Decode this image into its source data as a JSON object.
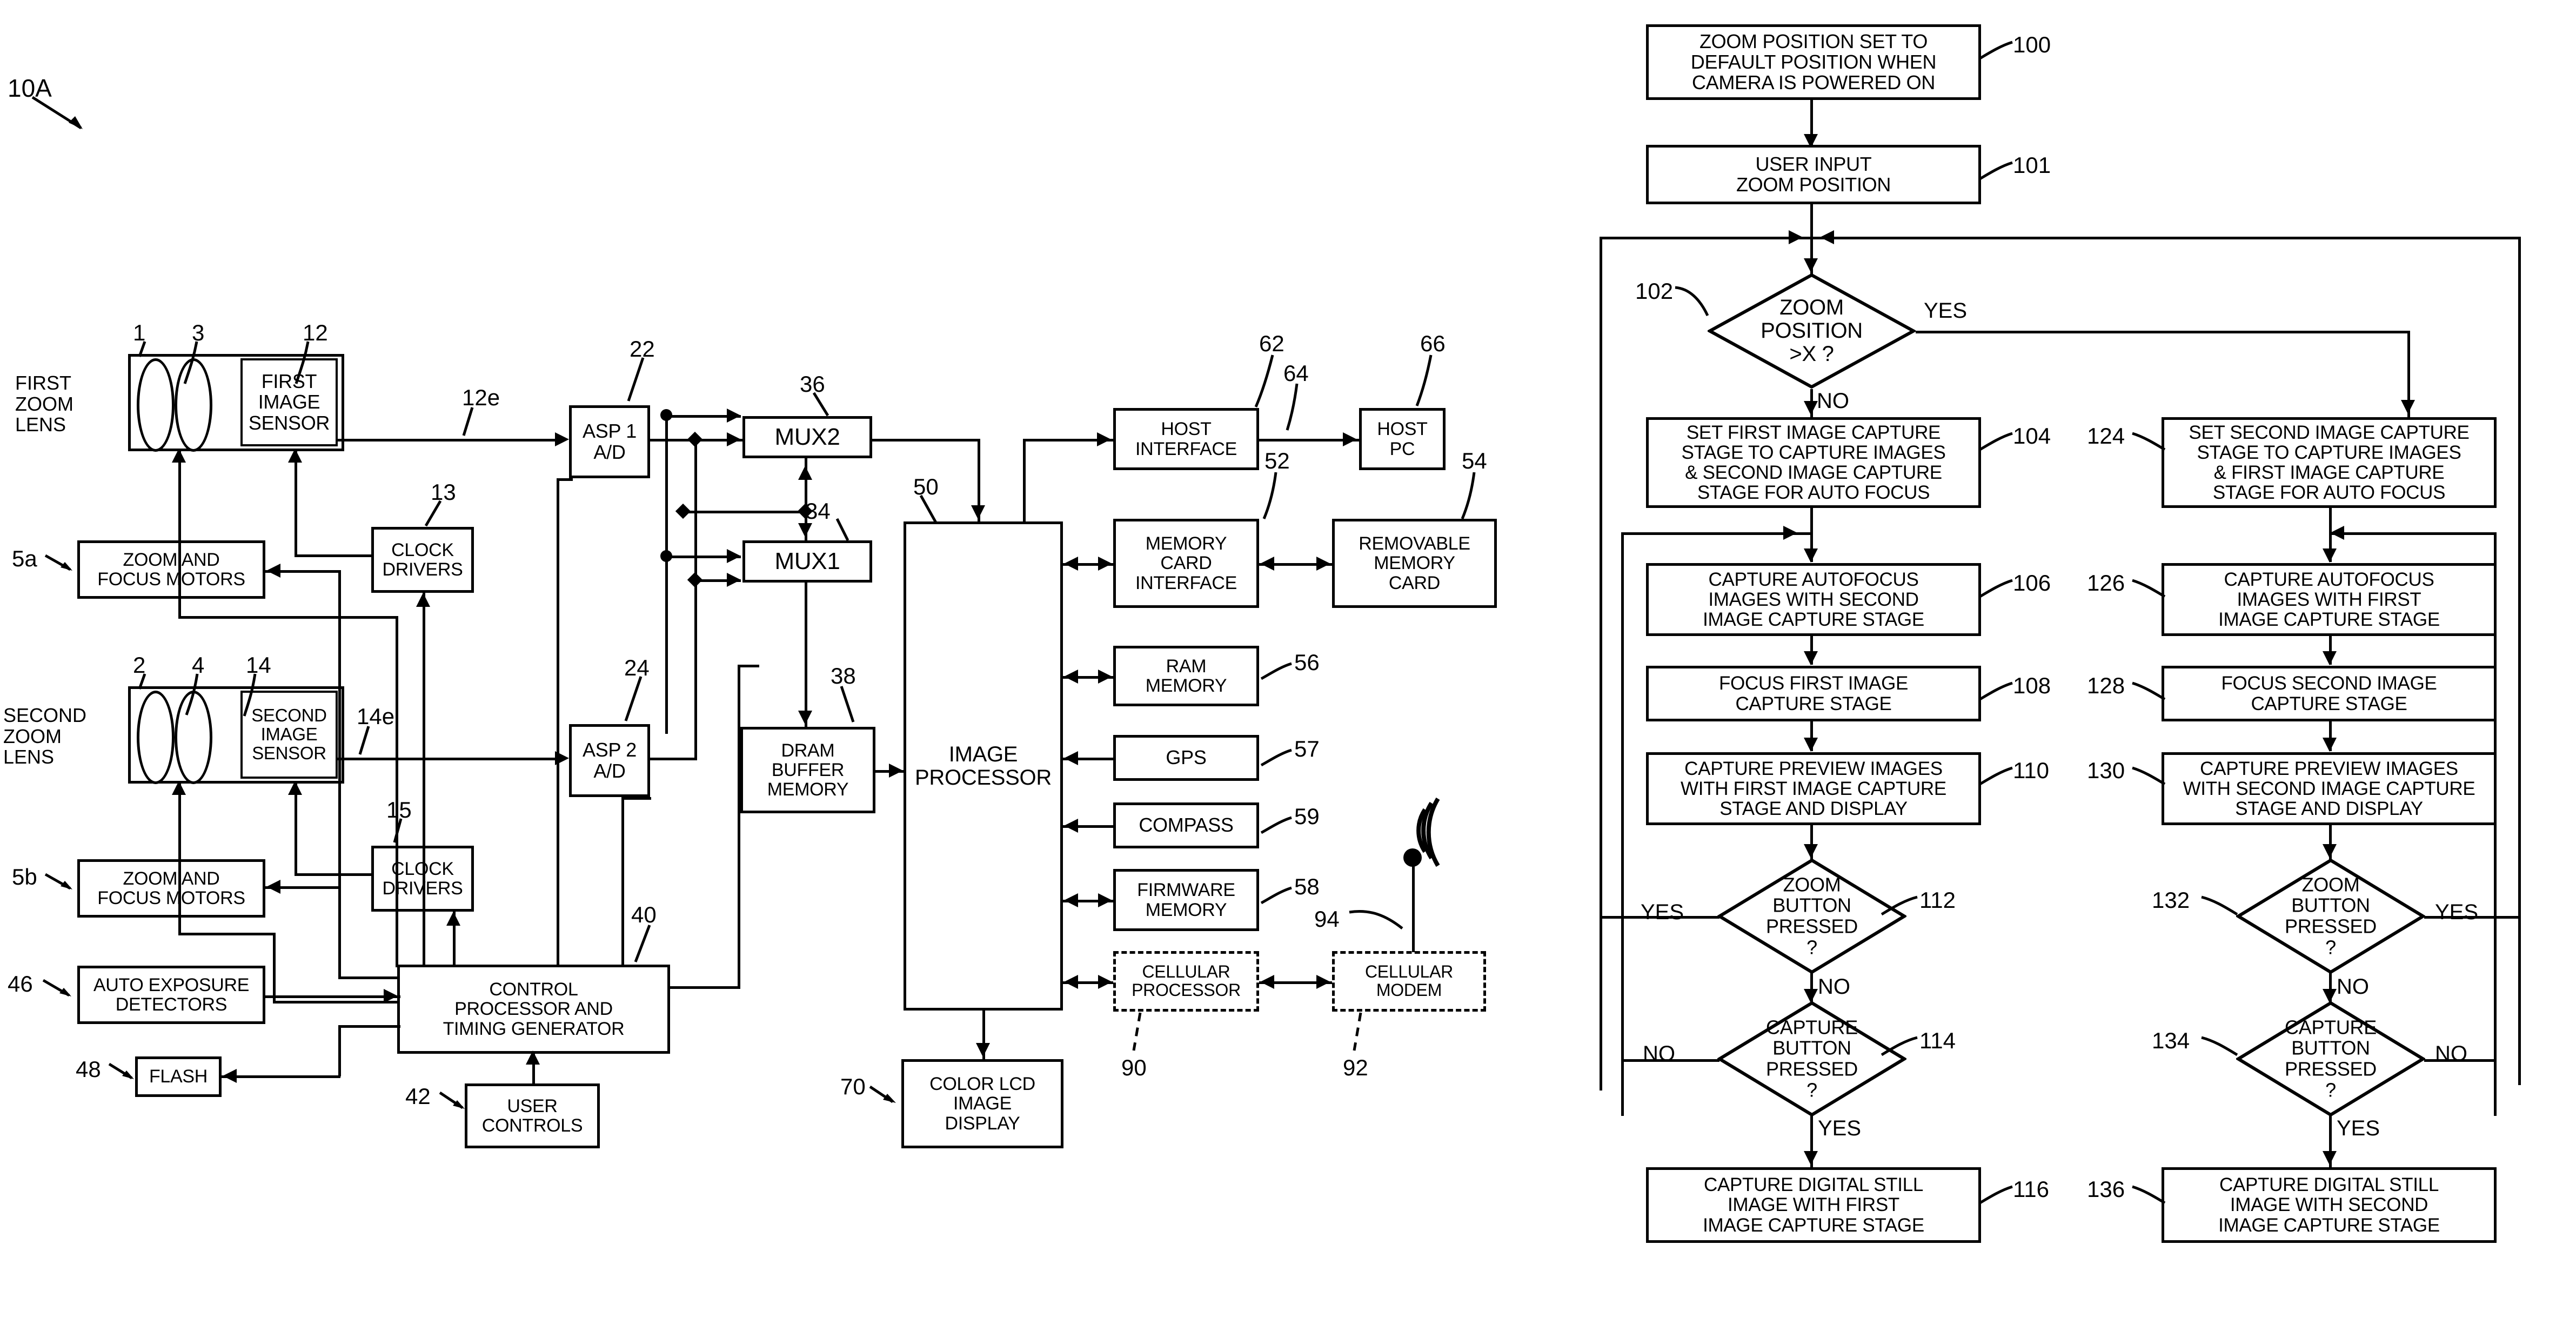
{
  "figure": {
    "system_ref": "10A",
    "left_title": "Digital camera block diagram",
    "right_title": "Zoom position control flowchart"
  },
  "camera_block_diagram": {
    "blocks": [
      {
        "id": "first_capture_stage",
        "ref": "1",
        "label": "FIRST\nZOOM\nLENS"
      },
      {
        "id": "first_lens_elem",
        "ref": "3",
        "label": ""
      },
      {
        "id": "first_image_sensor",
        "ref": "12",
        "label": "FIRST\nIMAGE\nSENSOR"
      },
      {
        "id": "zoom_focus_motors_a",
        "ref": "5a",
        "label": "ZOOM AND\nFOCUS MOTORS"
      },
      {
        "id": "clock_drivers_1",
        "ref": "13",
        "label": "CLOCK\nDRIVERS"
      },
      {
        "id": "second_capture_stage",
        "ref": "2",
        "label": "SECOND\nZOOM\nLENS"
      },
      {
        "id": "second_lens_elem",
        "ref": "4",
        "label": ""
      },
      {
        "id": "second_image_sensor",
        "ref": "14",
        "label": "SECOND\nIMAGE\nSENSOR"
      },
      {
        "id": "zoom_focus_motors_b",
        "ref": "5b",
        "label": "ZOOM AND\nFOCUS MOTORS"
      },
      {
        "id": "clock_drivers_2",
        "ref": "15",
        "label": "CLOCK\nDRIVERS"
      },
      {
        "id": "auto_exposure",
        "ref": "46",
        "label": "AUTO EXPOSURE\nDETECTORS"
      },
      {
        "id": "flash",
        "ref": "48",
        "label": "FLASH"
      },
      {
        "id": "control_processor",
        "ref": "40",
        "label": "CONTROL\nPROCESSOR AND\nTIMING GENERATOR"
      },
      {
        "id": "user_controls",
        "ref": "42",
        "label": "USER\nCONTROLS"
      },
      {
        "id": "asp1",
        "ref": "22",
        "label": "ASP 1\nA/D"
      },
      {
        "id": "asp2",
        "ref": "24",
        "label": "ASP 2\nA/D"
      },
      {
        "id": "mux2",
        "ref": "36",
        "label": "MUX2"
      },
      {
        "id": "mux1",
        "ref": "34",
        "label": "MUX1"
      },
      {
        "id": "dram_buffer",
        "ref": "38",
        "label": "DRAM\nBUFFER\nMEMORY"
      },
      {
        "id": "image_processor",
        "ref": "50",
        "label": "IMAGE\nPROCESSOR"
      },
      {
        "id": "host_interface",
        "ref": "62",
        "label": "HOST\nINTERFACE"
      },
      {
        "id": "host_pc",
        "ref": "66",
        "label": "HOST\nPC"
      },
      {
        "id": "memory_card_iface",
        "ref": "52",
        "label": "MEMORY\nCARD\nINTERFACE"
      },
      {
        "id": "removable_card",
        "ref": "54",
        "label": "REMOVABLE\nMEMORY\nCARD"
      },
      {
        "id": "ram_memory",
        "ref": "56",
        "label": "RAM\nMEMORY"
      },
      {
        "id": "gps",
        "ref": "57",
        "label": "GPS"
      },
      {
        "id": "compass",
        "ref": "59",
        "label": "COMPASS"
      },
      {
        "id": "firmware_memory",
        "ref": "58",
        "label": "FIRMWARE\nMEMORY"
      },
      {
        "id": "cellular_processor",
        "ref": "90",
        "label": "CELLULAR\nPROCESSOR"
      },
      {
        "id": "cellular_modem",
        "ref": "92",
        "label": "CELLULAR\nMODEM"
      },
      {
        "id": "antenna",
        "ref": "94",
        "label": ""
      },
      {
        "id": "color_lcd",
        "ref": "70",
        "label": "COLOR LCD\nIMAGE\nDISPLAY"
      }
    ],
    "signal_labels": [
      {
        "id": "first_sensor_output",
        "ref": "12e"
      },
      {
        "id": "second_sensor_output",
        "ref": "14e"
      },
      {
        "id": "host_link",
        "ref": "64"
      }
    ],
    "text": {
      "first_zoom_lens": "FIRST\nZOOM\nLENS",
      "first_zoom_lens_l1": "FIRST",
      "first_zoom_lens_l2": "ZOOM",
      "first_zoom_lens_l3": "LENS",
      "second_zoom_lens_l1": "SECOND",
      "second_zoom_lens_l2": "ZOOM",
      "second_zoom_lens_l3": "LENS",
      "first_image_sensor_l1": "FIRST",
      "first_image_sensor_l2": "IMAGE",
      "first_image_sensor_l3": "SENSOR",
      "second_image_sensor_l1": "SECOND",
      "second_image_sensor_l2": "IMAGE",
      "second_image_sensor_l3": "SENSOR",
      "zoom_focus_motors_l1": "ZOOM AND",
      "zoom_focus_motors_l2": "FOCUS MOTORS",
      "clock_drivers_l1": "CLOCK",
      "clock_drivers_l2": "DRIVERS",
      "auto_exposure_l1": "AUTO EXPOSURE",
      "auto_exposure_l2": "DETECTORS",
      "flash": "FLASH",
      "control_processor_l1": "CONTROL",
      "control_processor_l2": "PROCESSOR AND",
      "control_processor_l3": "TIMING GENERATOR",
      "user_controls_l1": "USER",
      "user_controls_l2": "CONTROLS",
      "asp1_l1": "ASP 1",
      "asp1_l2": "A/D",
      "asp2_l1": "ASP 2",
      "asp2_l2": "A/D",
      "mux2": "MUX2",
      "mux1": "MUX1",
      "dram_l1": "DRAM",
      "dram_l2": "BUFFER",
      "dram_l3": "MEMORY",
      "image_processor_l1": "IMAGE",
      "image_processor_l2": "PROCESSOR",
      "host_interface_l1": "HOST",
      "host_interface_l2": "INTERFACE",
      "host_pc_l1": "HOST",
      "host_pc_l2": "PC",
      "memory_card_iface_l1": "MEMORY",
      "memory_card_iface_l2": "CARD",
      "memory_card_iface_l3": "INTERFACE",
      "removable_card_l1": "REMOVABLE",
      "removable_card_l2": "MEMORY",
      "removable_card_l3": "CARD",
      "ram_memory_l1": "RAM",
      "ram_memory_l2": "MEMORY",
      "gps": "GPS",
      "compass": "COMPASS",
      "firmware_memory_l1": "FIRMWARE",
      "firmware_memory_l2": "MEMORY",
      "cellular_processor_l1": "CELLULAR",
      "cellular_processor_l2": "PROCESSOR",
      "cellular_modem_l1": "CELLULAR",
      "cellular_modem_l2": "MODEM",
      "color_lcd_l1": "COLOR LCD",
      "color_lcd_l2": "IMAGE",
      "color_lcd_l3": "DISPLAY"
    },
    "refs": {
      "system": "10A",
      "n1": "1",
      "n2": "2",
      "n3": "3",
      "n4": "4",
      "n5a": "5a",
      "n5b": "5b",
      "n12": "12",
      "n12e": "12e",
      "n13": "13",
      "n14": "14",
      "n14e": "14e",
      "n15": "15",
      "n22": "22",
      "n24": "24",
      "n34": "34",
      "n36": "36",
      "n38": "38",
      "n40": "40",
      "n42": "42",
      "n46": "46",
      "n48": "48",
      "n50": "50",
      "n52": "52",
      "n54": "54",
      "n56": "56",
      "n57": "57",
      "n58": "58",
      "n59": "59",
      "n62": "62",
      "n64": "64",
      "n66": "66",
      "n70": "70",
      "n90": "90",
      "n92": "92",
      "n94": "94"
    }
  },
  "flowchart": {
    "refs": {
      "n100": "100",
      "n101": "101",
      "n102": "102",
      "n104": "104",
      "n106": "106",
      "n108": "108",
      "n110": "110",
      "n112": "112",
      "n114": "114",
      "n116": "116",
      "n124": "124",
      "n126": "126",
      "n128": "128",
      "n130": "130",
      "n132": "132",
      "n134": "134",
      "n136": "136"
    },
    "steps": [
      {
        "ref": "100",
        "type": "process",
        "text": "ZOOM POSITION SET TO\nDEFAULT POSITION WHEN\nCAMERA IS POWERED ON"
      },
      {
        "ref": "101",
        "type": "process",
        "text": "USER INPUT\nZOOM POSITION"
      },
      {
        "ref": "102",
        "type": "decision",
        "text": "ZOOM\nPOSITION\n>X ?",
        "yes": "YES",
        "no": "NO"
      },
      {
        "ref": "104",
        "type": "process",
        "text": "SET FIRST IMAGE CAPTURE\nSTAGE TO CAPTURE IMAGES\n& SECOND IMAGE CAPTURE\nSTAGE FOR AUTO FOCUS"
      },
      {
        "ref": "106",
        "type": "process",
        "text": "CAPTURE AUTOFOCUS\nIMAGES WITH SECOND\nIMAGE CAPTURE STAGE"
      },
      {
        "ref": "108",
        "type": "process",
        "text": "FOCUS FIRST IMAGE\nCAPTURE STAGE"
      },
      {
        "ref": "110",
        "type": "process",
        "text": "CAPTURE PREVIEW IMAGES\nWITH FIRST IMAGE CAPTURE\nSTAGE AND DISPLAY"
      },
      {
        "ref": "112",
        "type": "decision",
        "text": "ZOOM\nBUTTON\nPRESSED\n?",
        "yes": "YES",
        "no": "NO"
      },
      {
        "ref": "114",
        "type": "decision",
        "text": "CAPTURE\nBUTTON\nPRESSED\n?",
        "yes": "YES",
        "no": "NO"
      },
      {
        "ref": "116",
        "type": "process",
        "text": "CAPTURE DIGITAL STILL\nIMAGE WITH FIRST\nIMAGE CAPTURE STAGE"
      },
      {
        "ref": "124",
        "type": "process",
        "text": "SET SECOND IMAGE CAPTURE\nSTAGE TO CAPTURE IMAGES\n& FIRST IMAGE CAPTURE\nSTAGE FOR AUTO FOCUS"
      },
      {
        "ref": "126",
        "type": "process",
        "text": "CAPTURE AUTOFOCUS\nIMAGES WITH FIRST\nIMAGE CAPTURE STAGE"
      },
      {
        "ref": "128",
        "type": "process",
        "text": "FOCUS SECOND IMAGE\nCAPTURE STAGE"
      },
      {
        "ref": "130",
        "type": "process",
        "text": "CAPTURE PREVIEW IMAGES\nWITH SECOND IMAGE CAPTURE\nSTAGE AND DISPLAY"
      },
      {
        "ref": "132",
        "type": "decision",
        "text": "ZOOM\nBUTTON\nPRESSED\n?",
        "yes": "YES",
        "no": "NO"
      },
      {
        "ref": "134",
        "type": "decision",
        "text": "CAPTURE\nBUTTON\nPRESSED\n?",
        "yes": "YES",
        "no": "NO"
      },
      {
        "ref": "136",
        "type": "process",
        "text": "CAPTURE DIGITAL STILL\nIMAGE WITH SECOND\nIMAGE CAPTURE STAGE"
      }
    ],
    "text": {
      "s100_l1": "ZOOM POSITION SET TO",
      "s100_l2": "DEFAULT POSITION WHEN",
      "s100_l3": "CAMERA IS POWERED ON",
      "s101_l1": "USER INPUT",
      "s101_l2": "ZOOM POSITION",
      "s102_l1": "ZOOM",
      "s102_l2": "POSITION",
      "s102_l3": ">X ?",
      "s104_l1": "SET FIRST IMAGE CAPTURE",
      "s104_l2": "STAGE TO CAPTURE IMAGES",
      "s104_l3": "& SECOND IMAGE CAPTURE",
      "s104_l4": "STAGE FOR AUTO FOCUS",
      "s106_l1": "CAPTURE AUTOFOCUS",
      "s106_l2": "IMAGES WITH SECOND",
      "s106_l3": "IMAGE CAPTURE STAGE",
      "s108_l1": "FOCUS FIRST IMAGE",
      "s108_l2": "CAPTURE STAGE",
      "s110_l1": "CAPTURE PREVIEW IMAGES",
      "s110_l2": "WITH FIRST IMAGE CAPTURE",
      "s110_l3": "STAGE AND DISPLAY",
      "s112_l1": "ZOOM",
      "s112_l2": "BUTTON",
      "s112_l3": "PRESSED",
      "s112_l4": "?",
      "s114_l1": "CAPTURE",
      "s114_l2": "BUTTON",
      "s114_l3": "PRESSED",
      "s114_l4": "?",
      "s116_l1": "CAPTURE DIGITAL STILL",
      "s116_l2": "IMAGE WITH FIRST",
      "s116_l3": "IMAGE CAPTURE STAGE",
      "s124_l1": "SET SECOND IMAGE CAPTURE",
      "s124_l2": "STAGE TO CAPTURE IMAGES",
      "s124_l3": "& FIRST IMAGE CAPTURE",
      "s124_l4": "STAGE FOR AUTO FOCUS",
      "s126_l1": "CAPTURE AUTOFOCUS",
      "s126_l2": "IMAGES WITH FIRST",
      "s126_l3": "IMAGE CAPTURE STAGE",
      "s128_l1": "FOCUS SECOND IMAGE",
      "s128_l2": "CAPTURE STAGE",
      "s130_l1": "CAPTURE PREVIEW IMAGES",
      "s130_l2": "WITH SECOND IMAGE CAPTURE",
      "s130_l3": "STAGE AND DISPLAY",
      "s132_l1": "ZOOM",
      "s132_l2": "BUTTON",
      "s132_l3": "PRESSED",
      "s132_l4": "?",
      "s134_l1": "CAPTURE",
      "s134_l2": "BUTTON",
      "s134_l3": "PRESSED",
      "s134_l4": "?",
      "s136_l1": "CAPTURE DIGITAL STILL",
      "s136_l2": "IMAGE WITH SECOND",
      "s136_l3": "IMAGE CAPTURE STAGE",
      "yes": "YES",
      "no": "NO"
    }
  },
  "colors": {
    "ink": "#000000",
    "paper": "#ffffff"
  }
}
